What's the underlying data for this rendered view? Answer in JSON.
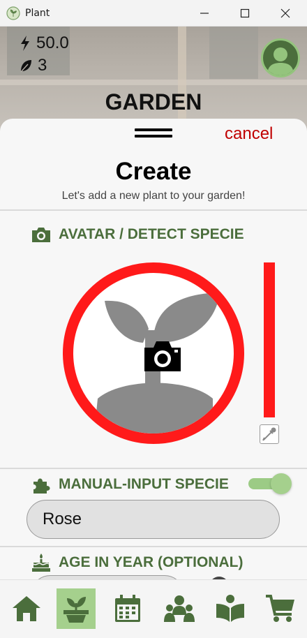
{
  "window": {
    "title": "Plant"
  },
  "header": {
    "energy": "50.0",
    "leaves": "3",
    "title": "GARDEN"
  },
  "sheet": {
    "cancel_label": "cancel",
    "title": "Create",
    "subtitle": "Let's add a new plant to your garden!",
    "sections": {
      "avatar": {
        "label": "AVATAR / DETECT SPECIE"
      },
      "manual": {
        "label": "MANUAL-INPUT SPECIE",
        "toggle_on": true,
        "value": "Rose"
      },
      "age": {
        "label": "AGE IN YEAR (OPTIONAL)"
      }
    }
  },
  "nav": {
    "items": [
      {
        "icon": "home-icon",
        "active": false
      },
      {
        "icon": "potted-plant-icon",
        "active": true
      },
      {
        "icon": "calendar-icon",
        "active": false
      },
      {
        "icon": "community-icon",
        "active": false
      },
      {
        "icon": "book-icon",
        "active": false
      },
      {
        "icon": "cart-icon",
        "active": false
      }
    ]
  },
  "colors": {
    "accent_green": "#4b6e3c",
    "light_green": "#a5d08d",
    "cancel_red": "#c00000",
    "highlight_red": "#ff1a1a"
  }
}
